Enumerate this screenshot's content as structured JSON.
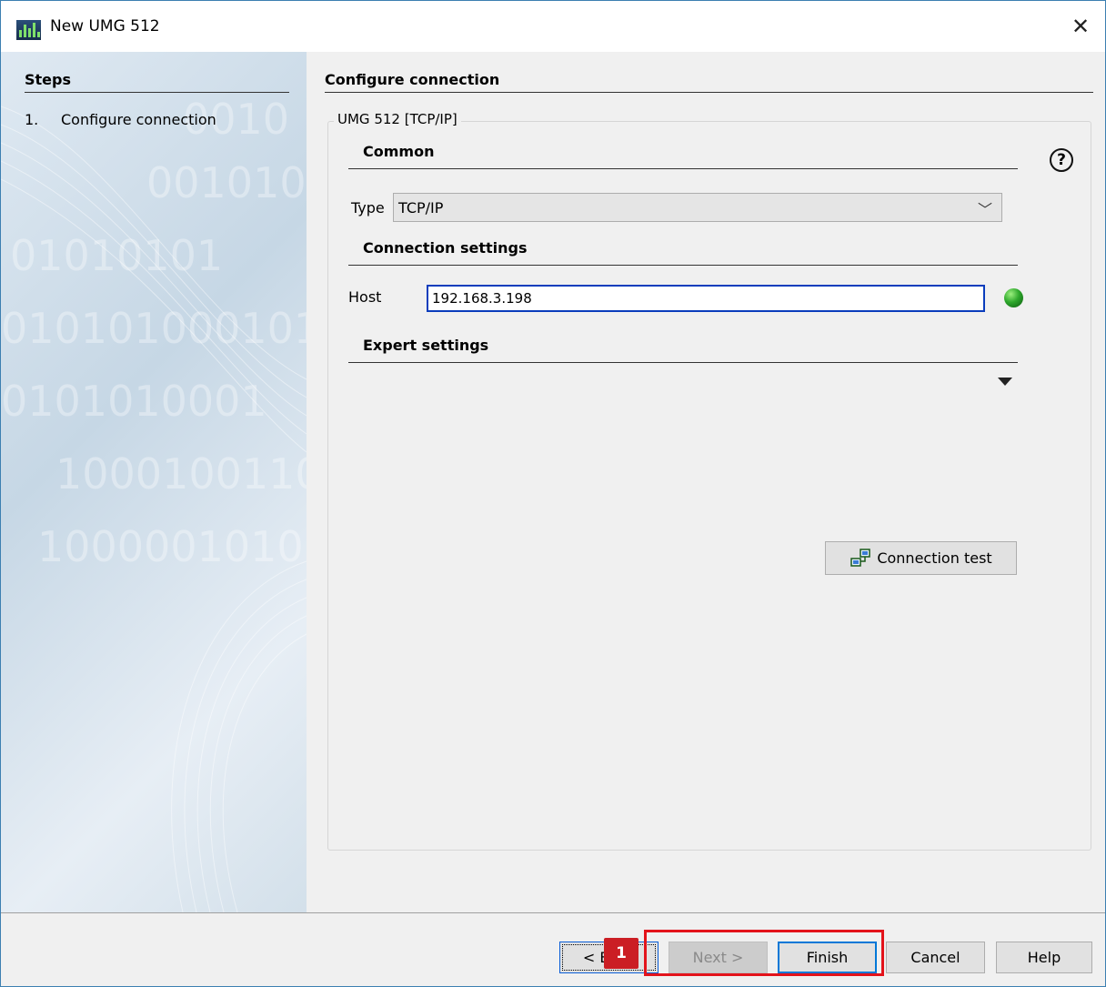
{
  "window": {
    "title": "New UMG 512"
  },
  "steps": {
    "title": "Steps",
    "items": [
      {
        "number": "1.",
        "label": "Configure connection"
      }
    ]
  },
  "content": {
    "title": "Configure connection",
    "group_label": "UMG 512 [TCP/IP]",
    "common": {
      "title": "Common",
      "type_label": "Type",
      "type_value": "TCP/IP"
    },
    "connection_settings": {
      "title": "Connection settings",
      "host_label": "Host",
      "host_value": "192.168.3.198",
      "status_color": "#2ea82c"
    },
    "expert_settings": {
      "title": "Expert settings"
    },
    "connection_test_label": "Connection test"
  },
  "footer": {
    "back_label": "< Back",
    "next_label": "Next >",
    "finish_label": "Finish",
    "cancel_label": "Cancel",
    "help_label": "Help"
  },
  "annotation": {
    "badge": "1",
    "color": "#e3131b"
  }
}
